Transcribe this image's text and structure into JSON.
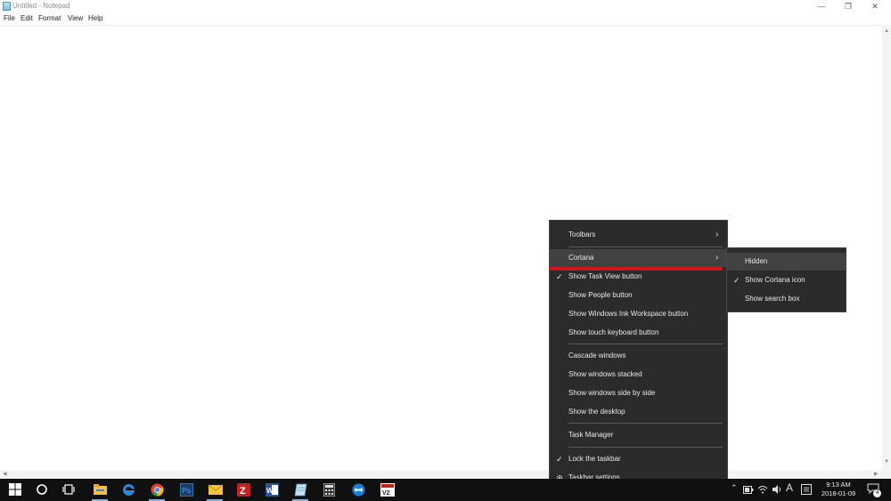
{
  "window": {
    "title": "Untitled - Notepad",
    "min_glyph": "—",
    "max_glyph": "❐",
    "close_glyph": "✕"
  },
  "menubar": [
    "File",
    "Edit",
    "Format",
    "View",
    "Help"
  ],
  "context_menu": {
    "toolbars": "Toolbars",
    "cortana": "Cortana",
    "task_view": "Show Task View button",
    "people": "Show People button",
    "ink": "Show Windows Ink Workspace button",
    "touch_keyboard": "Show touch keyboard button",
    "cascade": "Cascade windows",
    "stacked": "Show windows stacked",
    "side_by_side": "Show windows side by side",
    "desktop": "Show the desktop",
    "task_manager": "Task Manager",
    "lock": "Lock the taskbar",
    "settings": "Taskbar settings",
    "check_glyph": "✓",
    "arrow_glyph": "›"
  },
  "cortana_submenu": {
    "hidden": "Hidden",
    "show_icon": "Show Cortana icon",
    "search_box": "Show search box",
    "check_glyph": "✓"
  },
  "taskbar": {
    "clock_time": "9:13 AM",
    "clock_date": "2018-01-09",
    "ime_indicator": "A",
    "notification_count": "4",
    "colors": {
      "background": "#101010",
      "explorer": "#f3c33c",
      "edge": "#2f86d4",
      "photoshop": "#1b3b6d",
      "filezilla": "#c0241c",
      "word": "#2b579a",
      "teamviewer": "#1a7fd7"
    },
    "icons": [
      "windows-start-icon",
      "cortana-circle-icon",
      "task-view-icon",
      "file-explorer-icon",
      "edge-icon",
      "chrome-icon",
      "photoshop-icon",
      "mail-icon",
      "filezilla-icon",
      "word-icon",
      "notepad-icon",
      "calculator-icon",
      "teamviewer-icon",
      "vnc-icon"
    ]
  },
  "accent_colors": {
    "menu_bg": "#2b2b2b",
    "menu_hover": "#414141",
    "highlight_underline": "#d8141b"
  }
}
